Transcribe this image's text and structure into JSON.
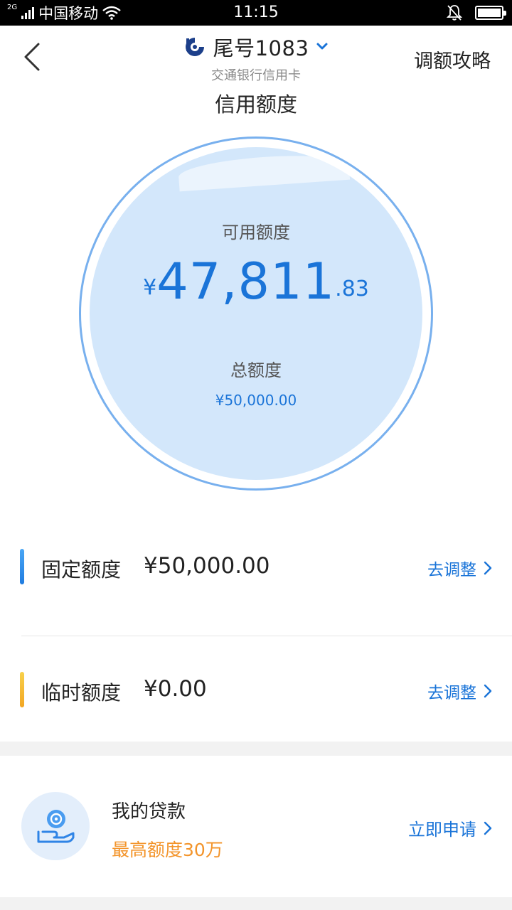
{
  "status_bar": {
    "network": "2G",
    "carrier": "中国移动",
    "time": "11:15",
    "battery_level": 1.0
  },
  "header": {
    "card_tail": "尾号1083",
    "bank_name": "交通银行信用卡",
    "page_title": "信用额度",
    "strategy_link": "调额攻略"
  },
  "summary": {
    "available_label": "可用额度",
    "currency_symbol": "¥",
    "available_int": "47,811",
    "available_dec": ".83",
    "total_label": "总额度",
    "total_amount": "¥50,000.00"
  },
  "limits": [
    {
      "label": "固定额度",
      "value": "¥50,000.00",
      "action": "去调整",
      "accent": "#2f8cf0"
    },
    {
      "label": "临时额度",
      "value": "¥0.00",
      "action": "去调整",
      "accent": "#f5b72a"
    }
  ],
  "loan": {
    "title": "我的贷款",
    "subtitle": "最高额度30万",
    "action": "立即申请"
  },
  "colors": {
    "accent_blue": "#1a74d8",
    "circle_fill": "#d3e7fb",
    "circle_ring": "#78b0ee",
    "orange": "#f3942a"
  }
}
